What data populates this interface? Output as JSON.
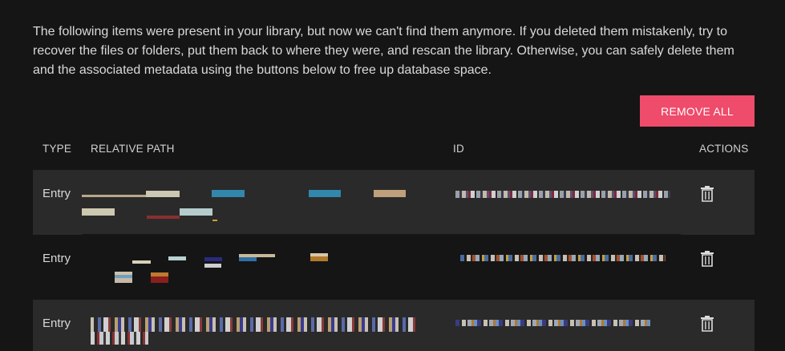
{
  "description": "The following items were present in your library, but now we can't find them anymore. If you deleted them mistakenly, try to recover the files or folders, put them back to where they were, and rescan the library. Otherwise, you can safely delete them and the associated metadata using the buttons below to free up database space.",
  "remove_all_label": "REMOVE ALL",
  "columns": {
    "type": "TYPE",
    "relative_path": "RELATIVE PATH",
    "id": "ID",
    "actions": "ACTIONS"
  },
  "rows": [
    {
      "type": "Entry",
      "path_redacted": true,
      "id_redacted": true,
      "action_icon": "trash-icon"
    },
    {
      "type": "Entry",
      "path_redacted": true,
      "id_redacted": true,
      "action_icon": "trash-icon"
    },
    {
      "type": "Entry",
      "path_redacted": true,
      "id_redacted": true,
      "action_icon": "trash-icon"
    }
  ],
  "colors": {
    "background": "#151515",
    "row_shaded": "#2a2a2a",
    "accent_button": "#ef4b6a"
  }
}
